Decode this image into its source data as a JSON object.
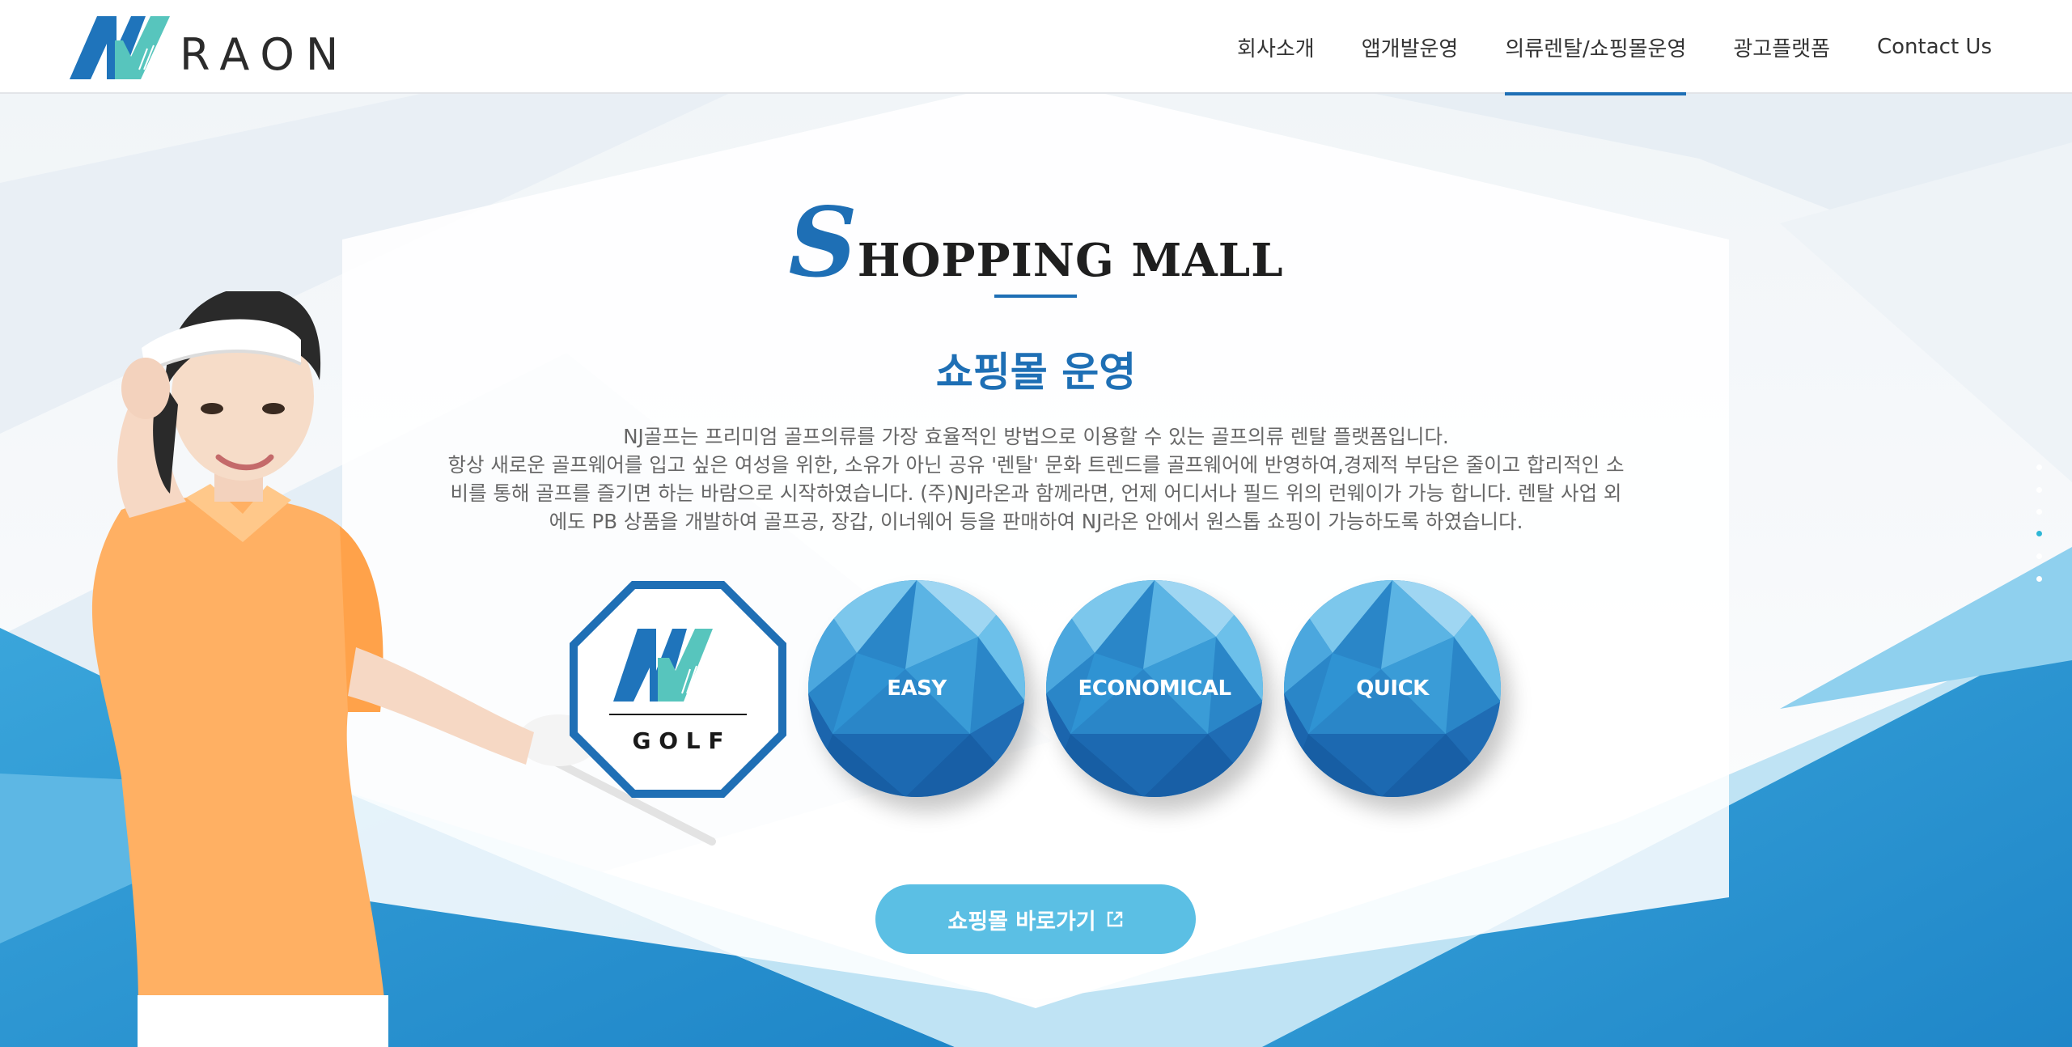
{
  "header": {
    "logo_text": "RAON",
    "nav": [
      {
        "label": "회사소개",
        "active": false
      },
      {
        "label": "앱개발운영",
        "active": false
      },
      {
        "label": "의류렌탈/쇼핑몰운영",
        "active": true
      },
      {
        "label": "광고플랫폼",
        "active": false
      },
      {
        "label": "Contact Us",
        "active": false
      }
    ]
  },
  "section": {
    "title_initial": "S",
    "title_rest": "HOPPING MALL",
    "subtitle": "쇼핑몰 운영",
    "description_lines": [
      "NJ골프는 프리미엄 골프의류를 가장 효율적인 방법으로 이용할 수 있는 골프의류 렌탈 플랫폼입니다.",
      "항상 새로운 골프웨어를 입고 싶은 여성을 위한, 소유가 아닌 공유 '렌탈' 문화 트렌드를 골프웨어에 반영하여,경제적 부담은 줄이고 합리적인 소",
      "비를 통해 골프를 즐기면 하는 바람으로 시작하였습니다. (주)NJ라온과 함께라면, 언제 어디서나 필드 위의 런웨이가 가능 합니다. 렌탈 사업 외",
      "에도 PB 상품을 개발하여 골프공, 장갑, 이너웨어 등을 판매하여 NJ라온 안에서 원스톱 쇼핑이 가능하도록 하였습니다."
    ],
    "golf_badge_text": "G O L F",
    "features": [
      "EASY",
      "ECONOMICAL",
      "QUICK"
    ],
    "cta_label": "쇼핑몰 바로가기"
  },
  "pager": {
    "count": 6,
    "active_index": 3
  },
  "colors": {
    "brand_blue": "#1e6fb5",
    "accent_teal": "#48c6c3",
    "cta_bg": "#5bbfe4",
    "text_gray": "#666666"
  },
  "icons": [
    "logo-mark-icon",
    "external-link-icon",
    "golf-logo-icon"
  ]
}
